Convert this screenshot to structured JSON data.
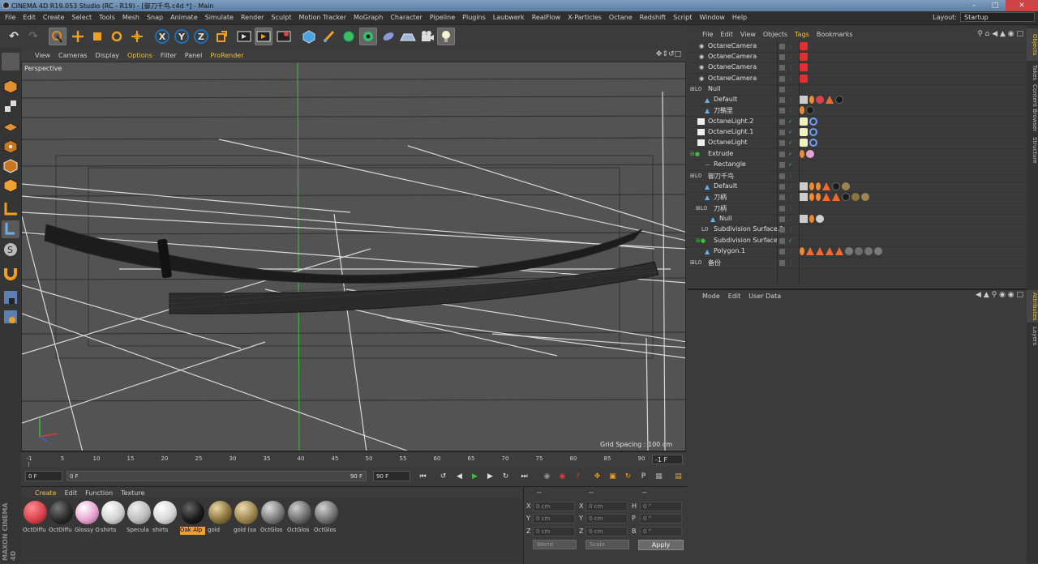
{
  "window": {
    "title": "CINEMA 4D R19.053 Studio (RC - R19) - [御刀千鸟.c4d *] - Main"
  },
  "menubar": {
    "items": [
      "File",
      "Edit",
      "Create",
      "Select",
      "Tools",
      "Mesh",
      "Snap",
      "Animate",
      "Simulate",
      "Render",
      "Sculpt",
      "Motion Tracker",
      "MoGraph",
      "Character",
      "Pipeline",
      "Plugins",
      "Laubwerk",
      "RealFlow",
      "X-Particles",
      "Octane",
      "Redshift",
      "Script",
      "Window",
      "Help"
    ],
    "layout_label": "Layout:",
    "layout_value": "Startup"
  },
  "toolbar": {
    "x_label": "X",
    "y_label": "Y",
    "z_label": "Z"
  },
  "viewport": {
    "menu": [
      "View",
      "Cameras",
      "Display",
      "Options",
      "Filter",
      "Panel",
      "ProRender"
    ],
    "label": "Perspective",
    "grid_spacing": "Grid Spacing : 100 cm"
  },
  "timeline": {
    "ticks": [
      "-1",
      "5",
      "10",
      "15",
      "20",
      "25",
      "30",
      "35",
      "40",
      "45",
      "50",
      "55",
      "60",
      "65",
      "70",
      "75",
      "80",
      "85",
      "90"
    ],
    "current_frame": "-1 F"
  },
  "playback": {
    "start_field": "0 F",
    "range_left": "0 F",
    "range_right": "90 F",
    "end_field": "90 F"
  },
  "material_manager": {
    "menu": [
      "Create",
      "Edit",
      "Function",
      "Texture"
    ],
    "materials": [
      {
        "name": "OctDiffu",
        "color": "#d8424d"
      },
      {
        "name": "OctDiffu",
        "color": "#2a2a2a"
      },
      {
        "name": "Glossy O",
        "color": "#e6a3d2"
      },
      {
        "name": "shirts",
        "color": "#d0d0d0"
      },
      {
        "name": "Specula",
        "color": "#bdbdbd"
      },
      {
        "name": "shirts",
        "color": "#d6d6d6"
      },
      {
        "name": "Oak Alp",
        "color": "#1b1b1b"
      },
      {
        "name": "gold",
        "color": "#8a7440"
      },
      {
        "name": "gold (sa",
        "color": "#9c8550"
      },
      {
        "name": "OctGlos",
        "color": "#7a7a7a"
      },
      {
        "name": "OctGlos",
        "color": "#6d6d6d"
      },
      {
        "name": "OctGlos",
        "color": "#737373"
      }
    ]
  },
  "coordinates": {
    "headers": [
      "--",
      "--",
      "--"
    ],
    "rows": [
      {
        "l1": "X",
        "v1": "0 cm",
        "l2": "X",
        "v2": "0 cm",
        "l3": "H",
        "v3": "0 °"
      },
      {
        "l1": "Y",
        "v1": "0 cm",
        "l2": "Y",
        "v2": "0 cm",
        "l3": "P",
        "v3": "0 °"
      },
      {
        "l1": "Z",
        "v1": "0 cm",
        "l2": "Z",
        "v2": "0 cm",
        "l3": "B",
        "v3": "0 °"
      }
    ],
    "world": "World",
    "scale": "Scale",
    "apply": "Apply"
  },
  "object_manager": {
    "menu": [
      "File",
      "Edit",
      "View",
      "Objects",
      "Tags",
      "Bookmarks"
    ],
    "objects": [
      {
        "name": "OctaneCamera",
        "indent": 0
      },
      {
        "name": "OctaneCamera",
        "indent": 0
      },
      {
        "name": "OctaneCamera",
        "indent": 0
      },
      {
        "name": "OctaneCamera",
        "indent": 0
      },
      {
        "name": "Null",
        "indent": 0
      },
      {
        "name": "Default",
        "indent": 1
      },
      {
        "name": "刀鞘里",
        "indent": 1
      },
      {
        "name": "OctaneLight.2",
        "indent": 0
      },
      {
        "name": "OctaneLight.1",
        "indent": 0
      },
      {
        "name": "OctaneLight",
        "indent": 0
      },
      {
        "name": "Extrude",
        "indent": 0
      },
      {
        "name": "Rectangle",
        "indent": 1
      },
      {
        "name": "御刀千鸟",
        "indent": 0
      },
      {
        "name": "Default",
        "indent": 1
      },
      {
        "name": "刀柄",
        "indent": 1
      },
      {
        "name": "刀柄",
        "indent": 1
      },
      {
        "name": "Null",
        "indent": 2
      },
      {
        "name": "Subdivision Surface.1",
        "indent": 1
      },
      {
        "name": "Subdivision Surface",
        "indent": 1
      },
      {
        "name": "Polygon.1",
        "indent": 1
      },
      {
        "name": "备份",
        "indent": 0
      }
    ]
  },
  "attributes": {
    "menu": [
      "Mode",
      "Edit",
      "User Data"
    ]
  },
  "right_tabs": [
    "Objects",
    "Takes",
    "Content Browser",
    "Structure",
    "Attributes",
    "Layers"
  ]
}
